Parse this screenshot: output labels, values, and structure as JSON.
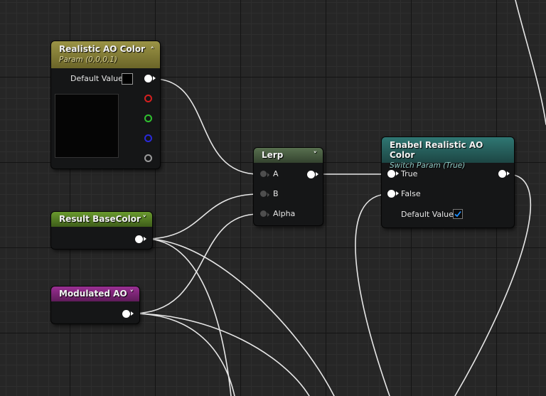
{
  "colors": {
    "param_header": "#8f8a3f",
    "switch_header": "#2f6e6a",
    "lerp_header": "#4f6b46",
    "base_header": "#5f8f2a",
    "ao_header": "#8e2f88",
    "canvas": "#262626"
  },
  "nodes": {
    "realistic_ao": {
      "title": "Realistic AO Color",
      "subtitle": "Param (0,0,0,1)",
      "default_label": "Default Value",
      "collapse_icon": "chevron-up-icon",
      "swatch_color": "#000000"
    },
    "lerp": {
      "title": "Lerp",
      "inputs": [
        "A",
        "B",
        "Alpha"
      ],
      "collapse_icon": "chevron-down-icon"
    },
    "switch": {
      "title": "Enabel Realistic AO Color",
      "subtitle": "Switch Param (True)",
      "inputs": [
        "True",
        "False"
      ],
      "default_label": "Default Value",
      "default_checked": true,
      "check_icon": "checkmark-icon"
    },
    "base_color": {
      "title": "Result BaseColor",
      "collapse_icon": "chevron-down-icon"
    },
    "modulated_ao": {
      "title": "Modulated AO",
      "collapse_icon": "chevron-down-icon"
    }
  }
}
